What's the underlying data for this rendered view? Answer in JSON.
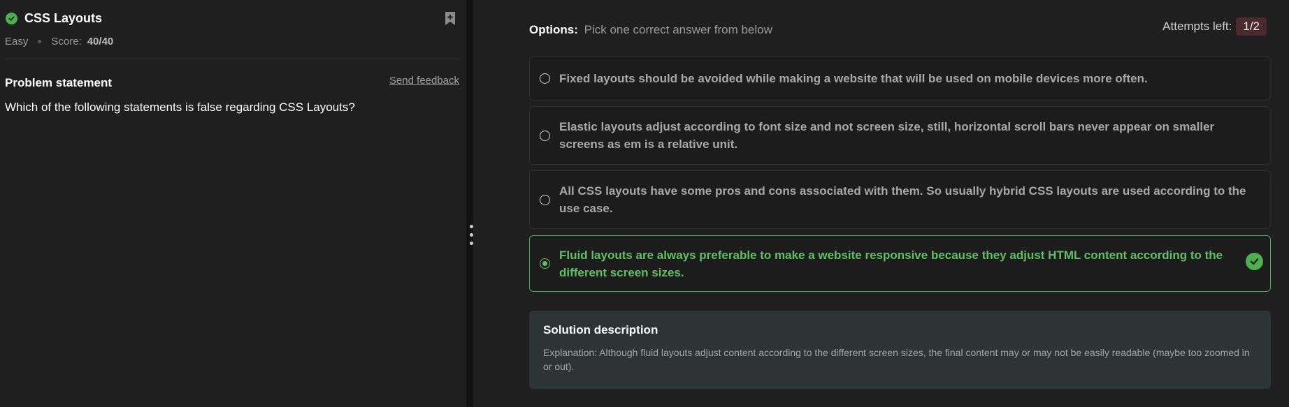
{
  "problem": {
    "title": "CSS Layouts",
    "difficulty": "Easy",
    "score_label": "Score:",
    "score_value": "40/40",
    "statement_heading": "Problem statement",
    "send_feedback": "Send feedback",
    "statement": "Which of the following statements is false regarding CSS Layouts?"
  },
  "options_header": {
    "label": "Options:",
    "instruction": "Pick one correct answer from below"
  },
  "attempts": {
    "label": "Attempts left:",
    "value": "1/2"
  },
  "options": [
    {
      "text": "Fixed layouts should be avoided while making a website that will be used on mobile devices more often.",
      "selected": false
    },
    {
      "text": "Elastic layouts adjust according to font size and not screen size, still, horizontal scroll bars never appear on smaller screens as em is a relative unit.",
      "selected": false
    },
    {
      "text": "All CSS layouts have some pros and cons associated with them. So usually hybrid CSS layouts are used according to the use case.",
      "selected": false
    },
    {
      "text": "Fluid layouts are always preferable to make a website responsive because they adjust HTML content according to the different screen sizes.",
      "selected": true,
      "correct": true
    }
  ],
  "solution": {
    "heading": "Solution description",
    "text": "Explanation: Although fluid layouts adjust content according to the different screen sizes, the final content may or may not be easily readable (maybe too zoomed in or out)."
  },
  "colors": {
    "correct": "#4caf50",
    "attempts_badge": "#4a2a2c",
    "solution_bg": "#2c3436"
  },
  "icons": {
    "status": "check-circle-icon",
    "bookmark": "bookmark-add-icon",
    "correct": "check-circle-icon",
    "splitter": "drag-handle-icon"
  }
}
